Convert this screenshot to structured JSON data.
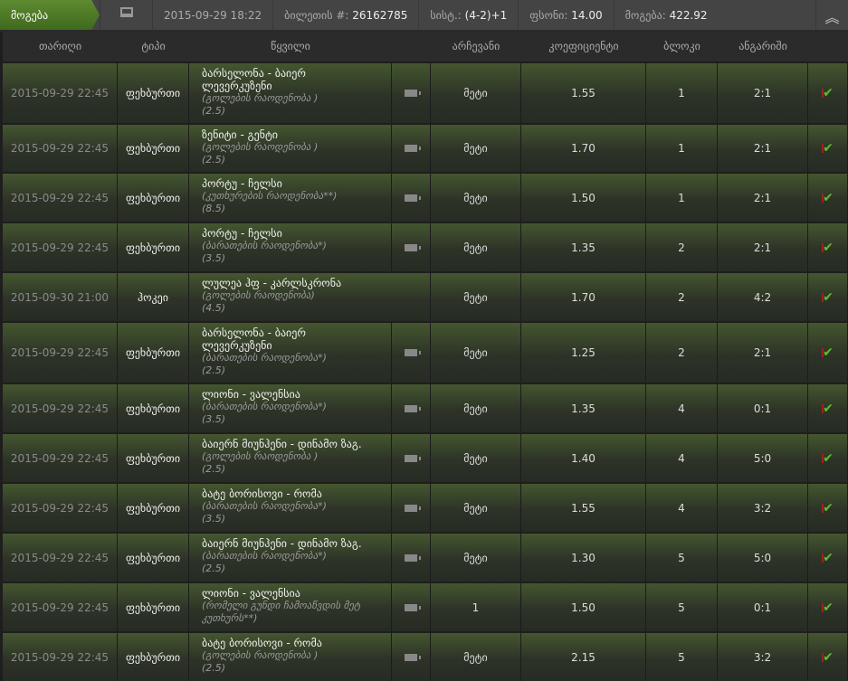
{
  "header": {
    "status": "მოგება",
    "datetime": "2015-09-29 18:22",
    "ticket_label": "ბილეთის #:",
    "ticket": "26162785",
    "system_label": "სისტ.:",
    "system": "(4-2)+1",
    "stake_label": "ფსონი:",
    "stake": "14.00",
    "win_label": "მოგება:",
    "win": "422.92"
  },
  "columns": [
    "თარიღი",
    "ტიპი",
    " წყვილი",
    "არჩევანი",
    "კოეფიციენტი",
    "ბლოკი",
    "ანგარიში"
  ],
  "rows": [
    {
      "date": "2015-09-29 22:45",
      "type": "ფეხბურთი",
      "event": "ბარსელონა - ბაიერ ლევერკუზენი",
      "market": "(გოლების რაოდენობა )",
      "line": "(2.5)",
      "video": true,
      "pick": "მეტი",
      "odds": "1.55",
      "block": "1",
      "score": "2:1"
    },
    {
      "date": "2015-09-29 22:45",
      "type": "ფეხბურთი",
      "event": "ზენიტი - გენტი",
      "market": "(გოლების რაოდენობა )",
      "line": "(2.5)",
      "video": true,
      "pick": "მეტი",
      "odds": "1.70",
      "block": "1",
      "score": "2:1"
    },
    {
      "date": "2015-09-29 22:45",
      "type": "ფეხბურთი",
      "event": "პორტუ - ჩელსი",
      "market": "(კუთხურების რაოდენობა**)",
      "line": "(8.5)",
      "video": true,
      "pick": "მეტი",
      "odds": "1.50",
      "block": "1",
      "score": "2:1"
    },
    {
      "date": "2015-09-29 22:45",
      "type": "ფეხბურთი",
      "event": "პორტუ - ჩელსი",
      "market": "(ბარათების რაოდენობა*)",
      "line": "(3.5)",
      "video": true,
      "pick": "მეტი",
      "odds": "1.35",
      "block": "2",
      "score": "2:1"
    },
    {
      "date": "2015-09-30 21:00",
      "type": "ჰოკეი",
      "event": "ლულეა ჰფ - კარლსკრონა",
      "market": "(გოლების რაოდენობა)",
      "line": "(4.5)",
      "video": false,
      "pick": "მეტი",
      "odds": "1.70",
      "block": "2",
      "score": "4:2"
    },
    {
      "date": "2015-09-29 22:45",
      "type": "ფეხბურთი",
      "event": "ბარსელონა - ბაიერ ლევერკუზენი",
      "market": "(ბარათების რაოდენობა*)",
      "line": "(2.5)",
      "video": true,
      "pick": "მეტი",
      "odds": "1.25",
      "block": "2",
      "score": "2:1"
    },
    {
      "date": "2015-09-29 22:45",
      "type": "ფეხბურთი",
      "event": "ლიონი - ვალენსია",
      "market": "(ბარათების რაოდენობა*)",
      "line": "(3.5)",
      "video": true,
      "pick": "მეტი",
      "odds": "1.35",
      "block": "4",
      "score": "0:1"
    },
    {
      "date": "2015-09-29 22:45",
      "type": "ფეხბურთი",
      "event": "ბაიერნ მიუნჰენი - დინამო ზაგ.",
      "market": "(გოლების რაოდენობა )",
      "line": "(2.5)",
      "video": true,
      "pick": "მეტი",
      "odds": "1.40",
      "block": "4",
      "score": "5:0"
    },
    {
      "date": "2015-09-29 22:45",
      "type": "ფეხბურთი",
      "event": "ბატე ბორისოვი - რომა",
      "market": "(ბარათების რაოდენობა*)",
      "line": "(3.5)",
      "video": true,
      "pick": "მეტი",
      "odds": "1.55",
      "block": "4",
      "score": "3:2"
    },
    {
      "date": "2015-09-29 22:45",
      "type": "ფეხბურთი",
      "event": "ბაიერნ მიუნჰენი - დინამო ზაგ.",
      "market": "(ბარათების რაოდენობა*)",
      "line": "(2.5)",
      "video": true,
      "pick": "მეტი",
      "odds": "1.30",
      "block": "5",
      "score": "5:0"
    },
    {
      "date": "2015-09-29 22:45",
      "type": "ფეხბურთი",
      "event": "ლიონი - ვალენსია",
      "market": "(რომელი გუნდი ჩამოაწვდის მეტ კუთხურს**)",
      "line": "",
      "video": true,
      "pick": "1",
      "odds": "1.50",
      "block": "5",
      "score": "0:1"
    },
    {
      "date": "2015-09-29 22:45",
      "type": "ფეხბურთი",
      "event": "ბატე ბორისოვი - რომა",
      "market": "(გოლების რაოდენობა )",
      "line": "(2.5)",
      "video": true,
      "pick": "მეტი",
      "odds": "2.15",
      "block": "5",
      "score": "3:2"
    }
  ]
}
